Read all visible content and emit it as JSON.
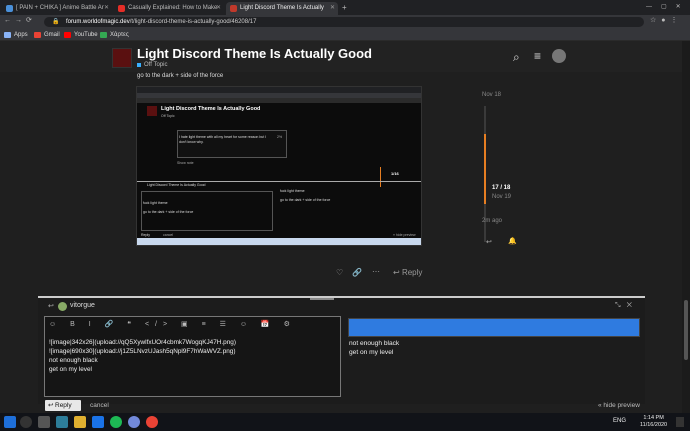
{
  "browser": {
    "tabs": [
      {
        "label": "[ PAIN + CHIKA ] Anime Battle Ar",
        "color": "#4a90d9",
        "active": false
      },
      {
        "label": "Casually Explained: How to Make",
        "color": "#e52d27",
        "active": false
      },
      {
        "label": "Light Discord Theme Is Actually",
        "color": "#c0392b",
        "active": true
      }
    ],
    "new_tab": "+",
    "url_host": "forum.worldofmagic.dev",
    "url_path": "/t/light-discord-theme-is-actually-good/46208/17",
    "bookmarks": [
      {
        "label": "Apps",
        "color": "#8ab4f8"
      },
      {
        "label": "Gmail",
        "color": "#ea4335"
      },
      {
        "label": "YouTube",
        "color": "#ff0000"
      },
      {
        "label": "Χάρτες",
        "color": "#34a853"
      }
    ]
  },
  "topic": {
    "title": "Light Discord Theme Is Actually Good",
    "category": "Off Topic",
    "post_text": "go to the dark + side of the force"
  },
  "embedded": {
    "title": "Light Discord Theme Is Actually Good",
    "category": "Off Topic",
    "quote": "I hate light theme with all my heart for some reason but I don't know why.",
    "percent": "2%",
    "show_note": "Show note",
    "counter": "1/16",
    "composer_title": "Light Discord Theme Is Actually Good",
    "line1": "fuck light theme",
    "line2": "go to the dark + side of the force",
    "preview1": "fuck light theme",
    "preview2": "go to the dark + side of the force",
    "reply": "Reply",
    "cancel": "cancel",
    "hide": "« hide preview"
  },
  "timeline": {
    "top_date": "Nov 18",
    "position": "17 / 18",
    "bottom_date": "Nov 19",
    "ago": "2m ago"
  },
  "post_actions": {
    "reply": "Reply"
  },
  "composer": {
    "user": "vitorgue",
    "toolbar_icons": "☺ B I 🔗 ❝ </> ▣ ≡ ☰ ☺ 📅 ⚙",
    "lines": [
      "![image|342x26](upload://qQ5XywlfxUOr4cbmk7WogqKJ47H.png)",
      "![image|690x30](upload://j1Z5LNvzUJash5qNpl9F7hWaWVZ.png)",
      "not enough black",
      "get on my level"
    ],
    "preview_lines": [
      "not enough black",
      "get on my level"
    ],
    "reply_label": "Reply",
    "cancel_label": "cancel",
    "hide_preview_label": "« hide preview"
  },
  "taskbar": {
    "lang": "ENG",
    "time": "1:14 PM",
    "date": "11/16/2020"
  },
  "colors": {
    "accent": "#e67e22",
    "category": "#3ab0ff"
  }
}
